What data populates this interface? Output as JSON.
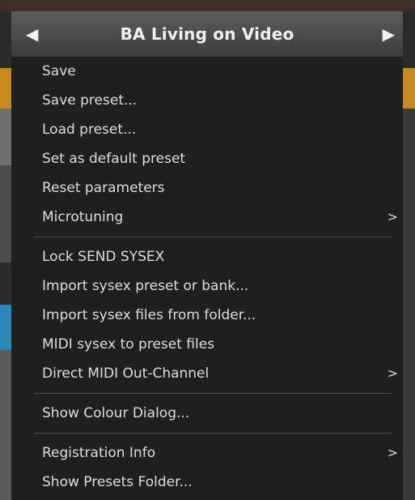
{
  "menu": {
    "title": "BA Living on Video",
    "prev_glyph": "◀",
    "next_glyph": "▶",
    "items": [
      {
        "label": "Save"
      },
      {
        "label": "Save preset..."
      },
      {
        "label": "Load preset..."
      },
      {
        "label": "Set as default preset"
      },
      {
        "label": "Reset parameters"
      },
      {
        "label": "Microtuning",
        "submenu": ">"
      },
      {
        "label": "Lock SEND SYSEX"
      },
      {
        "label": "Import sysex preset or bank..."
      },
      {
        "label": "Import sysex files from folder..."
      },
      {
        "label": "MIDI sysex to preset files"
      },
      {
        "label": "Direct MIDI Out-Channel",
        "submenu": ">"
      },
      {
        "label": "Show Colour Dialog..."
      },
      {
        "label": "Registration Info",
        "submenu": ">"
      },
      {
        "label": "Show Presets Folder..."
      }
    ]
  },
  "colors": {
    "menu_bg": "#1f1f1f",
    "header_bg": "#4a4a4a",
    "text": "#dddddd",
    "separator": "#4a4a4a"
  }
}
